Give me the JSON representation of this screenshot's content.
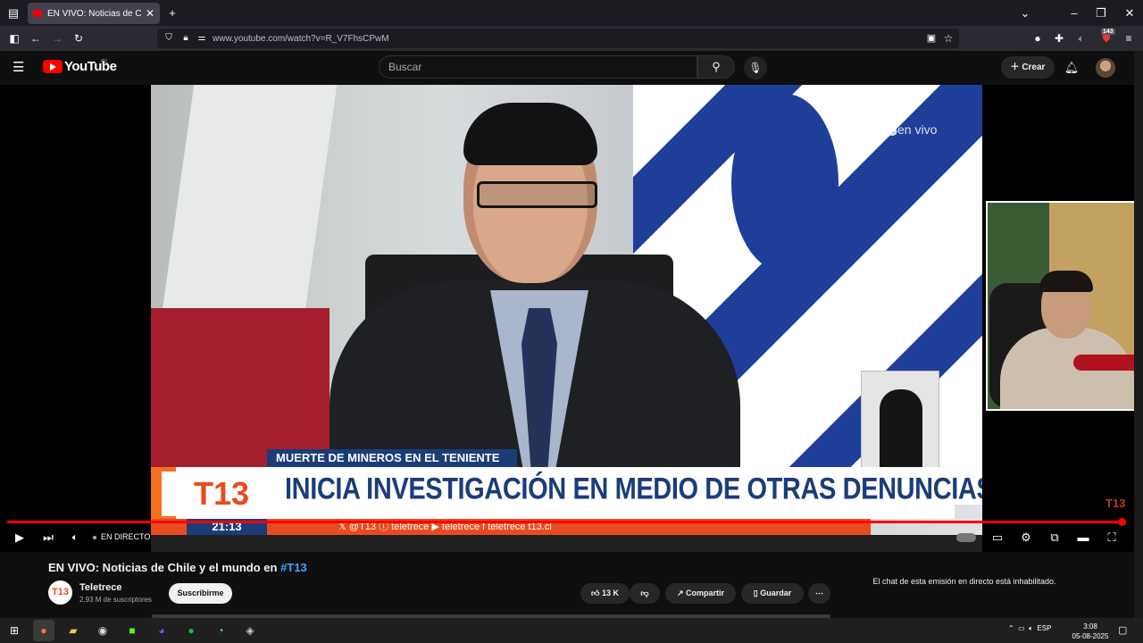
{
  "browser": {
    "tab_title": "EN VIVO: Noticias de Chile y el",
    "url": "www.youtube.com/watch?v=R_V7FhsCPwM",
    "extension_badge": "143"
  },
  "youtube": {
    "logo_text": "YouTube",
    "country_code": "CL",
    "search_placeholder": "Buscar",
    "create_label": "Crear"
  },
  "video": {
    "watermark": "T13",
    "watermark_sub": "en vivo",
    "lower_third": {
      "category": "MUERTE DE MINEROS EN EL TENIENTE",
      "brand": "T13",
      "headline": "INICIA INVESTIGACIÓN EN MEDIO DE OTRAS DENUNCIAS",
      "time": "21:13",
      "ticker": "𝕏 @T13   ⓘ teletrece   ▶ teletrece   f teletrece   t13.cl"
    },
    "corner_logo": "T13"
  },
  "player": {
    "live_label": "EN DIRECTO",
    "progress_fraction": 1.0
  },
  "details": {
    "title_prefix": "EN VIVO: Noticias de Chile y el mundo en ",
    "title_hashtag": "#T13",
    "channel_logo": "T13",
    "channel_name": "Teletrece",
    "subscribers": "2,93 M de suscriptores",
    "subscribe_label": "Suscribirme",
    "likes": "13 K",
    "share_label": "Compartir",
    "save_label": "Guardar",
    "chat_disabled": "El chat de esta emisión en directo está inhabilitado."
  },
  "taskbar": {
    "language": "ESP",
    "time": "3:08",
    "date": "05-08-2025"
  },
  "colors": {
    "youtube_red": "#ff0000",
    "t13_orange": "#e84c1e",
    "t13_blue": "#1a3d7a",
    "link_blue": "#3ea6ff"
  }
}
